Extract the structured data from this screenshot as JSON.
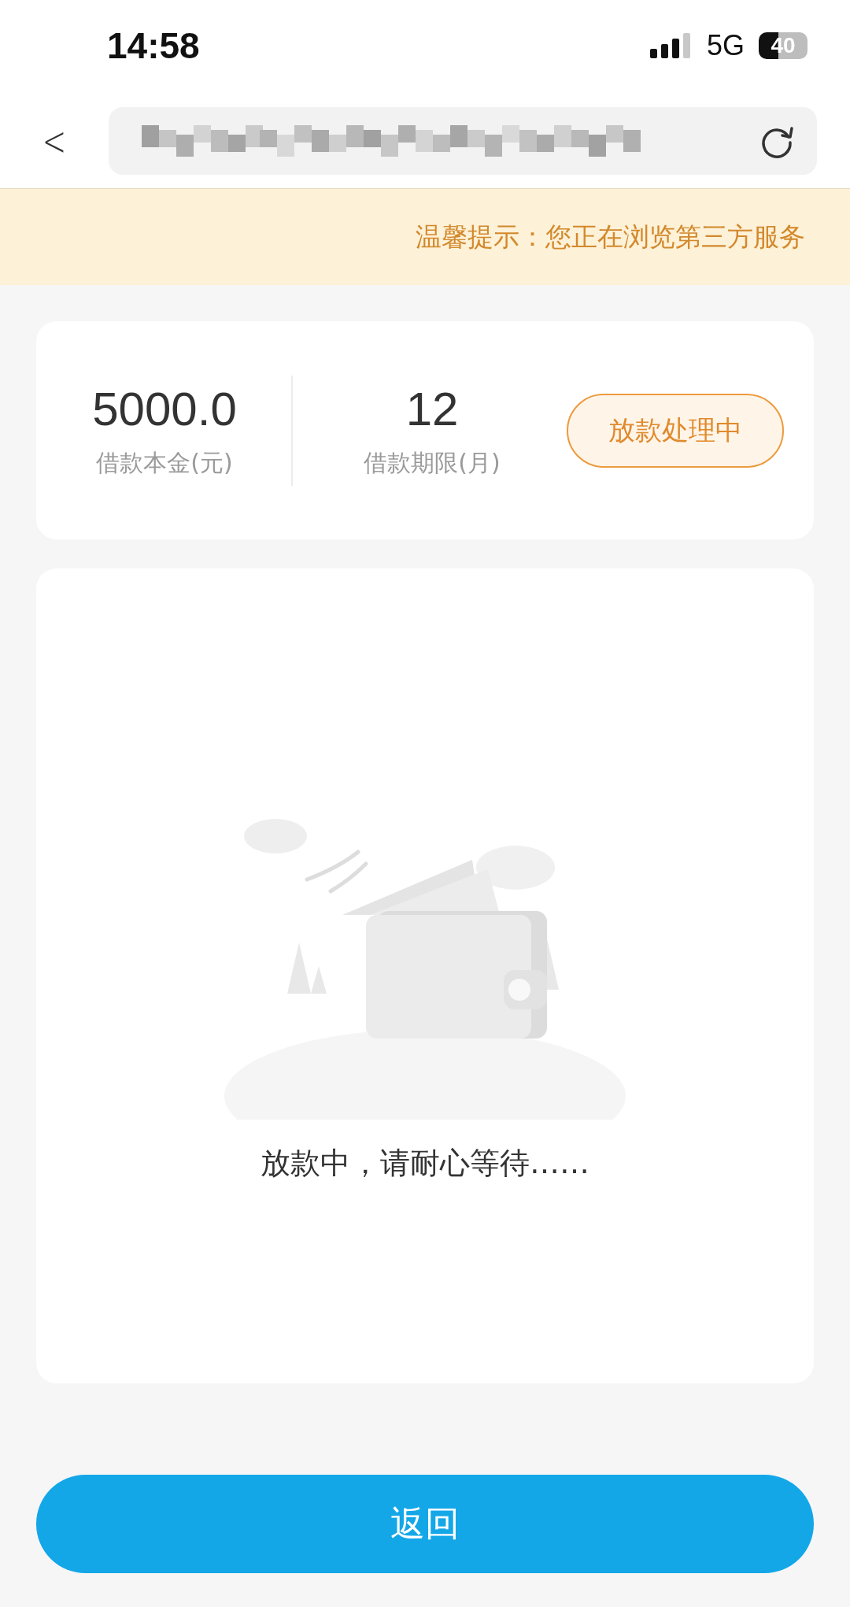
{
  "status_bar": {
    "time": "14:58",
    "network": "5G",
    "battery": "40"
  },
  "nav": {
    "back": "<"
  },
  "notice": {
    "text": "温馨提示：您正在浏览第三方服务"
  },
  "summary": {
    "items": [
      {
        "value": "5000.0",
        "label": "借款本金(元)"
      },
      {
        "value": "12",
        "label": "借款期限(月)"
      }
    ],
    "status": "放款处理中"
  },
  "waiting": {
    "kind": "picture",
    "message": "放款中，请耐心等待……"
  },
  "buttons": [
    {
      "label": "返回"
    }
  ]
}
